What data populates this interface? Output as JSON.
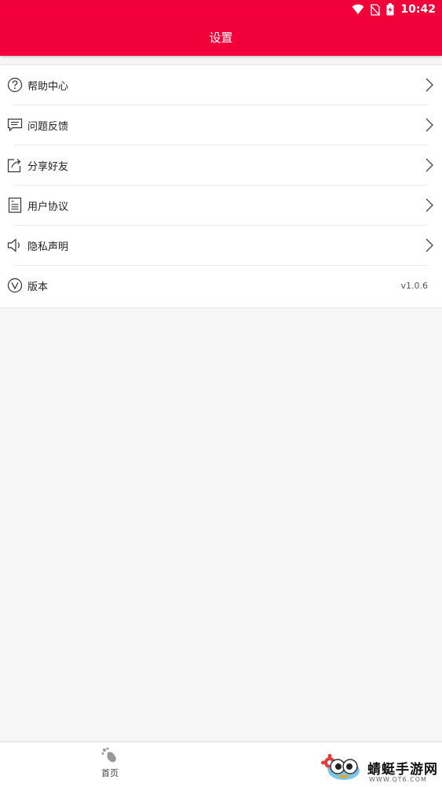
{
  "status_bar": {
    "time": "10:42",
    "icons": [
      "wifi-icon",
      "no-sim-icon",
      "battery-charging-icon"
    ]
  },
  "app_bar": {
    "title": "设置"
  },
  "settings_list": {
    "items": [
      {
        "icon": "help-circle-icon",
        "label": "帮助中心",
        "action": "chevron-right-icon"
      },
      {
        "icon": "chat-icon",
        "label": "问题反馈",
        "action": "chevron-right-icon"
      },
      {
        "icon": "share-icon",
        "label": "分享好友",
        "action": "chevron-right-icon"
      },
      {
        "icon": "document-icon",
        "label": "用户协议",
        "action": "chevron-right-icon"
      },
      {
        "icon": "speaker-icon",
        "label": "隐私声明",
        "action": "chevron-right-icon"
      },
      {
        "icon": "version-icon",
        "label": "版本",
        "value": "v1.0.6"
      }
    ]
  },
  "tab_bar": {
    "home_label": "首页",
    "home_icon": "home-icon",
    "settings_icon": "settings-icon"
  },
  "watermark": {
    "text": "蜻蜓手游网",
    "url": "WWW.QT6.COM"
  },
  "colors": {
    "brand": "#f2003a",
    "background": "#f6f6f6",
    "surface": "#ffffff"
  }
}
